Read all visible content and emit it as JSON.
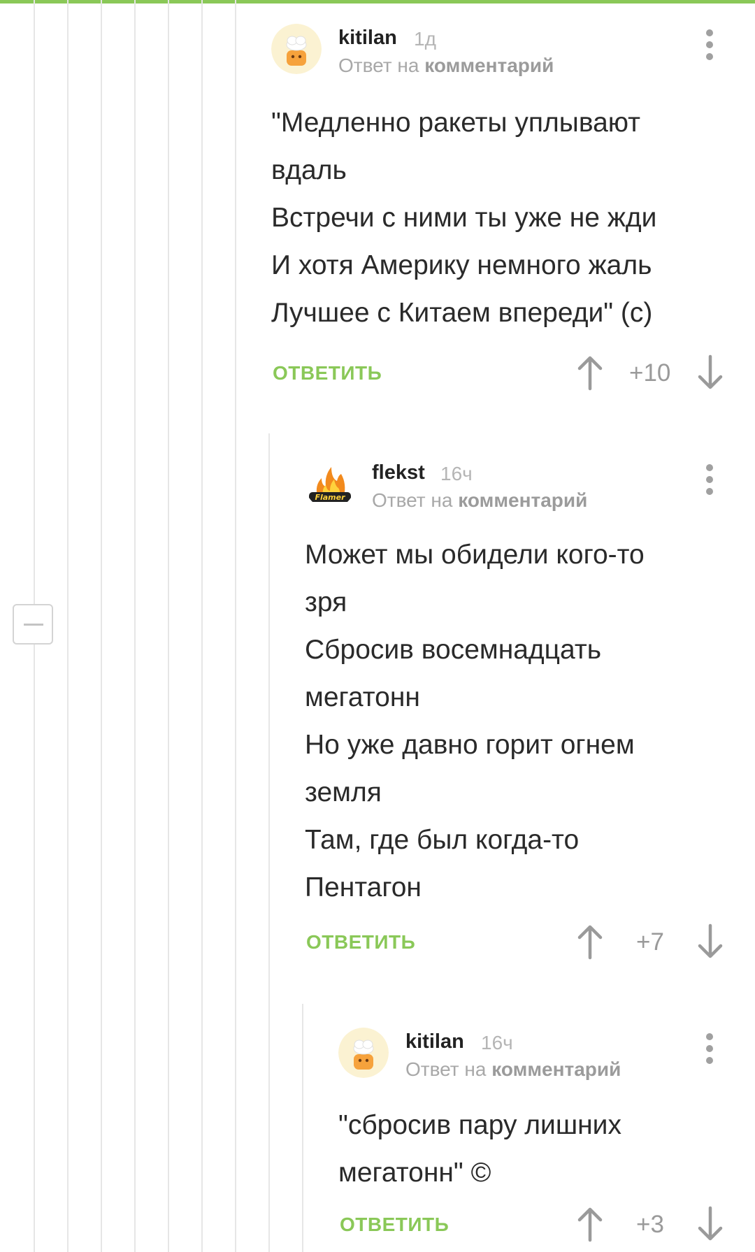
{
  "comments": [
    {
      "author": "kitilan",
      "time": "1д",
      "reply_prefix": "Ответ на",
      "reply_target": "комментарий",
      "lines": [
        "\"Медленно ракеты уплывают",
        "вдаль",
        "Встречи с ними ты уже не жди",
        "И хотя Америку немного жаль",
        "Лучшее с Китаем впереди\" (с)"
      ],
      "reply_label": "ОТВЕТИТЬ",
      "rating": "+10",
      "avatar": "chef-avatar"
    },
    {
      "author": "flekst",
      "time": "16ч",
      "reply_prefix": "Ответ на",
      "reply_target": "комментарий",
      "lines": [
        "Может мы обидели кого-то",
        "зря",
        "Сбросив восемнадцать",
        "мегатонн",
        "Но уже давно горит огнем",
        "земля",
        "Там, где был когда-то",
        "Пентагон"
      ],
      "reply_label": "ОТВЕТИТЬ",
      "rating": "+7",
      "avatar": "flamer-avatar",
      "avatar_text": "Flamer"
    },
    {
      "author": "kitilan",
      "time": "16ч",
      "reply_prefix": "Ответ на",
      "reply_target": "комментарий",
      "lines": [
        "\"сбросив пару лишних",
        "мегатонн\" ©"
      ],
      "reply_label": "ОТВЕТИТЬ",
      "rating": "+3",
      "avatar": "chef-avatar"
    }
  ],
  "colors": {
    "accent": "#8ac858",
    "muted": "#a8a8a8",
    "text": "#2a2a2a"
  },
  "icons": [
    "kebab-menu-icon",
    "upvote-arrow-icon",
    "downvote-arrow-icon",
    "collapse-minus-icon"
  ]
}
